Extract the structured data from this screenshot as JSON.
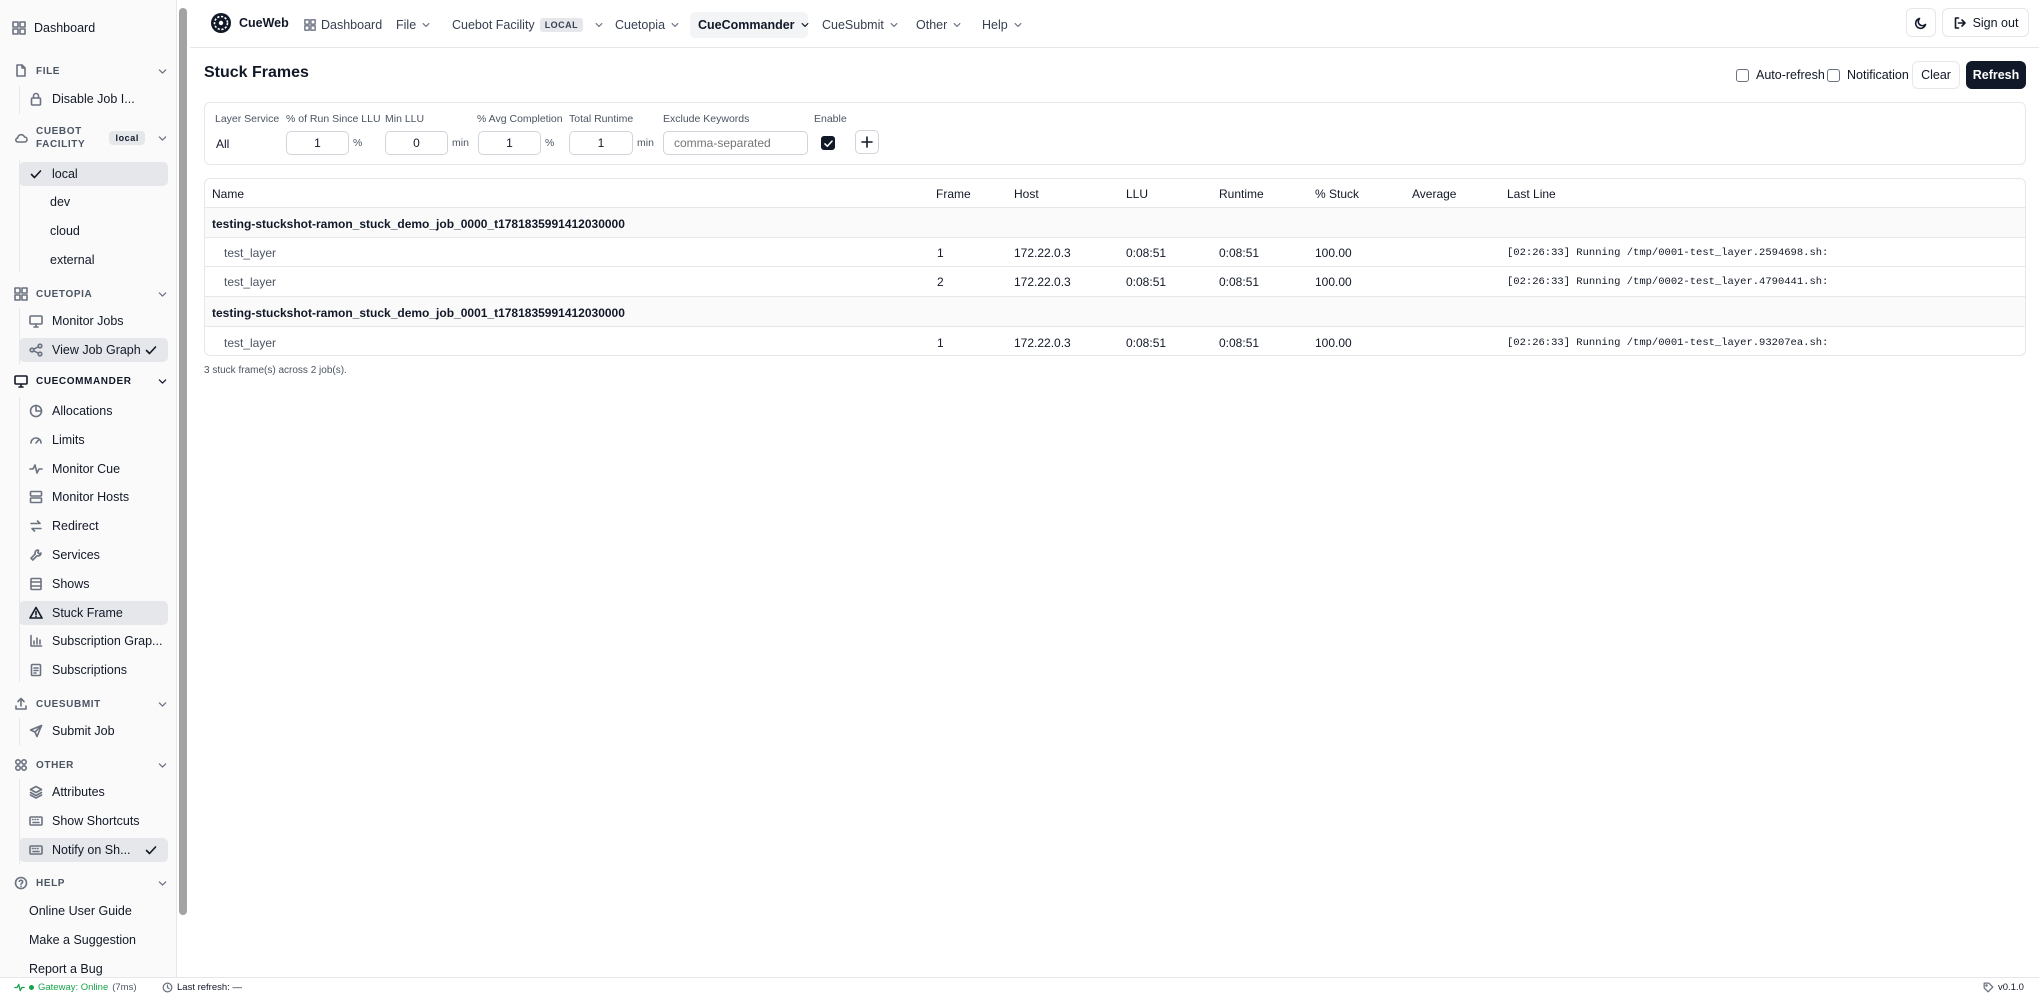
{
  "sidebar": {
    "dashboard": "Dashboard",
    "file": {
      "title": "FILE",
      "items": [
        {
          "label": "Disable Job I..."
        }
      ]
    },
    "cuebot": {
      "title": "CUEBOT FACILITY",
      "title_line1": "CUEBOT",
      "title_line2": "FACILITY",
      "badge": "local",
      "items": [
        {
          "label": "local"
        },
        {
          "label": "dev"
        },
        {
          "label": "cloud"
        },
        {
          "label": "external"
        }
      ]
    },
    "cuetopia": {
      "title": "CUETOPIA",
      "items": [
        {
          "label": "Monitor Jobs"
        },
        {
          "label": "View Job Graph"
        }
      ]
    },
    "cuecommander": {
      "title": "CUECOMMANDER",
      "items": [
        {
          "label": "Allocations"
        },
        {
          "label": "Limits"
        },
        {
          "label": "Monitor Cue"
        },
        {
          "label": "Monitor Hosts"
        },
        {
          "label": "Redirect"
        },
        {
          "label": "Services"
        },
        {
          "label": "Shows"
        },
        {
          "label": "Stuck Frame"
        },
        {
          "label": "Subscription Grap..."
        },
        {
          "label": "Subscriptions"
        }
      ]
    },
    "cuesubmit": {
      "title": "CUESUBMIT",
      "items": [
        {
          "label": "Submit Job"
        }
      ]
    },
    "other": {
      "title": "OTHER",
      "items": [
        {
          "label": "Attributes"
        },
        {
          "label": "Show Shortcuts"
        },
        {
          "label": "Notify on Sh..."
        }
      ]
    },
    "help": {
      "title": "HELP",
      "items": [
        {
          "label": "Online User Guide"
        },
        {
          "label": "Make a Suggestion"
        },
        {
          "label": "Report a Bug"
        }
      ]
    }
  },
  "topnav": {
    "brand": "CueWeb",
    "dashboard": "Dashboard",
    "file": "File",
    "facility": "Cuebot Facility",
    "facility_tag": "LOCAL",
    "cuetopia": "Cuetopia",
    "cuecommander": "CueCommander",
    "cuesubmit": "CueSubmit",
    "other": "Other",
    "help": "Help",
    "signout": "Sign out"
  },
  "page": {
    "title": "Stuck Frames",
    "auto_refresh": "Auto-refresh",
    "notification": "Notification",
    "clear": "Clear",
    "refresh": "Refresh"
  },
  "filters": {
    "layer_service": {
      "label": "Layer Service",
      "value": "All"
    },
    "run_since_llu": {
      "label": "% of Run Since LLU",
      "value": "1",
      "unit": "%"
    },
    "min_llu": {
      "label": "Min LLU",
      "value": "0",
      "unit": "min"
    },
    "avg_completion": {
      "label": "% Avg Completion",
      "value": "1",
      "unit": "%"
    },
    "total_runtime": {
      "label": "Total Runtime",
      "value": "1",
      "unit": "min"
    },
    "exclude_keywords": {
      "label": "Exclude Keywords",
      "placeholder": "comma-separated"
    },
    "enable": {
      "label": "Enable",
      "checked": true
    }
  },
  "table": {
    "headers": {
      "name": "Name",
      "frame": "Frame",
      "host": "Host",
      "llu": "LLU",
      "runtime": "Runtime",
      "stuck": "% Stuck",
      "average": "Average",
      "last_line": "Last Line"
    },
    "groups": [
      {
        "job": "testing-stuckshot-ramon_stuck_demo_job_0000_t1781835991412030000",
        "rows": [
          {
            "name": "test_layer",
            "frame": "1",
            "host": "172.22.0.3",
            "llu": "0:08:51",
            "runtime": "0:08:51",
            "stuck": "100.00",
            "average": "",
            "last_line": "[02:26:33] Running /tmp/0001-test_layer.2594698.sh:"
          },
          {
            "name": "test_layer",
            "frame": "2",
            "host": "172.22.0.3",
            "llu": "0:08:51",
            "runtime": "0:08:51",
            "stuck": "100.00",
            "average": "",
            "last_line": "[02:26:33] Running /tmp/0002-test_layer.4790441.sh:"
          }
        ]
      },
      {
        "job": "testing-stuckshot-ramon_stuck_demo_job_0001_t1781835991412030000",
        "rows": [
          {
            "name": "test_layer",
            "frame": "1",
            "host": "172.22.0.3",
            "llu": "0:08:51",
            "runtime": "0:08:51",
            "stuck": "100.00",
            "average": "",
            "last_line": "[02:26:33] Running /tmp/0001-test_layer.93207ea.sh:"
          }
        ]
      }
    ]
  },
  "summary": "3 stuck frame(s) across 2 job(s).",
  "statusbar": {
    "gateway": "Gateway: Online",
    "latency": "(7ms)",
    "last_refresh": "Last refresh: —",
    "version": "v0.1.0"
  },
  "colors": {
    "accent": "#111827",
    "online": "#16a34a",
    "active_bg": "#e5e7eb"
  }
}
